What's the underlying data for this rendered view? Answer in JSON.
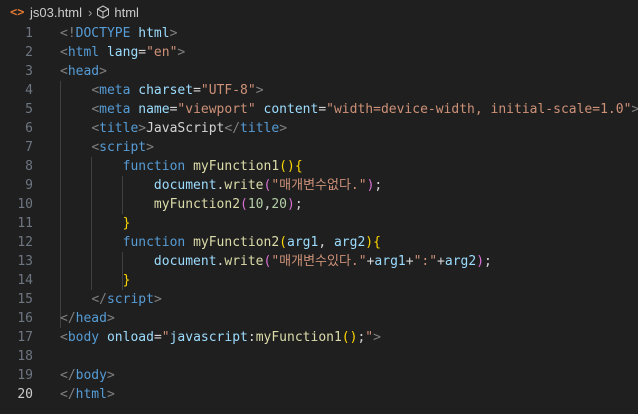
{
  "breadcrumb": {
    "file_icon": "<>",
    "file_name": "js03.html",
    "chevron": "›",
    "symbol_icon": "element-box-icon",
    "symbol_name": "html"
  },
  "editor": {
    "active_line": 20,
    "lines": [
      {
        "number": "1",
        "tokens": [
          {
            "t": "<!",
            "c": "punc"
          },
          {
            "t": "DOCTYPE",
            "c": "tag"
          },
          {
            "t": " ",
            "c": "text"
          },
          {
            "t": "html",
            "c": "attr"
          },
          {
            "t": ">",
            "c": "punc"
          }
        ]
      },
      {
        "number": "2",
        "tokens": [
          {
            "t": "<",
            "c": "punc"
          },
          {
            "t": "html",
            "c": "tag"
          },
          {
            "t": " ",
            "c": "text"
          },
          {
            "t": "lang",
            "c": "attr"
          },
          {
            "t": "=",
            "c": "text"
          },
          {
            "t": "\"en\"",
            "c": "str"
          },
          {
            "t": ">",
            "c": "punc"
          }
        ]
      },
      {
        "number": "3",
        "tokens": [
          {
            "t": "<",
            "c": "punc"
          },
          {
            "t": "head",
            "c": "tag"
          },
          {
            "t": ">",
            "c": "punc"
          }
        ]
      },
      {
        "number": "4",
        "tokens": [
          {
            "t": "    ",
            "c": "text"
          },
          {
            "t": "<",
            "c": "punc"
          },
          {
            "t": "meta",
            "c": "tag"
          },
          {
            "t": " ",
            "c": "text"
          },
          {
            "t": "charset",
            "c": "attr"
          },
          {
            "t": "=",
            "c": "text"
          },
          {
            "t": "\"UTF-8\"",
            "c": "str"
          },
          {
            "t": ">",
            "c": "punc"
          }
        ]
      },
      {
        "number": "5",
        "tokens": [
          {
            "t": "    ",
            "c": "text"
          },
          {
            "t": "<",
            "c": "punc"
          },
          {
            "t": "meta",
            "c": "tag"
          },
          {
            "t": " ",
            "c": "text"
          },
          {
            "t": "name",
            "c": "attr"
          },
          {
            "t": "=",
            "c": "text"
          },
          {
            "t": "\"viewport\"",
            "c": "str"
          },
          {
            "t": " ",
            "c": "text"
          },
          {
            "t": "content",
            "c": "attr"
          },
          {
            "t": "=",
            "c": "text"
          },
          {
            "t": "\"width=device-width, initial-scale=1.0\"",
            "c": "str"
          },
          {
            "t": ">",
            "c": "punc"
          }
        ]
      },
      {
        "number": "6",
        "tokens": [
          {
            "t": "    ",
            "c": "text"
          },
          {
            "t": "<",
            "c": "punc"
          },
          {
            "t": "title",
            "c": "tag"
          },
          {
            "t": ">",
            "c": "punc"
          },
          {
            "t": "JavaScript",
            "c": "text"
          },
          {
            "t": "</",
            "c": "punc"
          },
          {
            "t": "title",
            "c": "tag"
          },
          {
            "t": ">",
            "c": "punc"
          }
        ]
      },
      {
        "number": "7",
        "tokens": [
          {
            "t": "    ",
            "c": "text"
          },
          {
            "t": "<",
            "c": "punc"
          },
          {
            "t": "script",
            "c": "tag"
          },
          {
            "t": ">",
            "c": "punc"
          }
        ]
      },
      {
        "number": "8",
        "tokens": [
          {
            "t": "        ",
            "c": "text"
          },
          {
            "t": "function",
            "c": "kw"
          },
          {
            "t": " ",
            "c": "text"
          },
          {
            "t": "myFunction1",
            "c": "fn"
          },
          {
            "t": "()",
            "c": "br1"
          },
          {
            "t": "{",
            "c": "br1"
          }
        ]
      },
      {
        "number": "9",
        "tokens": [
          {
            "t": "            ",
            "c": "text"
          },
          {
            "t": "document",
            "c": "param"
          },
          {
            "t": ".",
            "c": "text"
          },
          {
            "t": "write",
            "c": "fn"
          },
          {
            "t": "(",
            "c": "br2"
          },
          {
            "t": "\"매개변수없다.\"",
            "c": "str"
          },
          {
            "t": ")",
            "c": "br2"
          },
          {
            "t": ";",
            "c": "text"
          }
        ]
      },
      {
        "number": "10",
        "tokens": [
          {
            "t": "            ",
            "c": "text"
          },
          {
            "t": "myFunction2",
            "c": "fn"
          },
          {
            "t": "(",
            "c": "br2"
          },
          {
            "t": "10",
            "c": "num"
          },
          {
            "t": ",",
            "c": "text"
          },
          {
            "t": "20",
            "c": "num"
          },
          {
            "t": ")",
            "c": "br2"
          },
          {
            "t": ";",
            "c": "text"
          }
        ]
      },
      {
        "number": "11",
        "tokens": [
          {
            "t": "        ",
            "c": "text"
          },
          {
            "t": "}",
            "c": "br1"
          }
        ]
      },
      {
        "number": "12",
        "tokens": [
          {
            "t": "        ",
            "c": "text"
          },
          {
            "t": "function",
            "c": "kw"
          },
          {
            "t": " ",
            "c": "text"
          },
          {
            "t": "myFunction2",
            "c": "fn"
          },
          {
            "t": "(",
            "c": "br1"
          },
          {
            "t": "arg1",
            "c": "param"
          },
          {
            "t": ", ",
            "c": "text"
          },
          {
            "t": "arg2",
            "c": "param"
          },
          {
            "t": ")",
            "c": "br1"
          },
          {
            "t": "{",
            "c": "br1"
          }
        ]
      },
      {
        "number": "13",
        "tokens": [
          {
            "t": "            ",
            "c": "text"
          },
          {
            "t": "document",
            "c": "param"
          },
          {
            "t": ".",
            "c": "text"
          },
          {
            "t": "write",
            "c": "fn"
          },
          {
            "t": "(",
            "c": "br2"
          },
          {
            "t": "\"매개변수있다.\"",
            "c": "str"
          },
          {
            "t": "+",
            "c": "op"
          },
          {
            "t": "arg1",
            "c": "param"
          },
          {
            "t": "+",
            "c": "op"
          },
          {
            "t": "\":\"",
            "c": "str"
          },
          {
            "t": "+",
            "c": "op"
          },
          {
            "t": "arg2",
            "c": "param"
          },
          {
            "t": ")",
            "c": "br2"
          },
          {
            "t": ";",
            "c": "text"
          }
        ]
      },
      {
        "number": "14",
        "tokens": [
          {
            "t": "        ",
            "c": "text"
          },
          {
            "t": "}",
            "c": "br1"
          }
        ]
      },
      {
        "number": "15",
        "tokens": [
          {
            "t": "    ",
            "c": "text"
          },
          {
            "t": "</",
            "c": "punc"
          },
          {
            "t": "script",
            "c": "tag"
          },
          {
            "t": ">",
            "c": "punc"
          }
        ]
      },
      {
        "number": "16",
        "tokens": [
          {
            "t": "</",
            "c": "punc"
          },
          {
            "t": "head",
            "c": "tag"
          },
          {
            "t": ">",
            "c": "punc"
          }
        ]
      },
      {
        "number": "17",
        "tokens": [
          {
            "t": "<",
            "c": "punc"
          },
          {
            "t": "body",
            "c": "tag"
          },
          {
            "t": " ",
            "c": "text"
          },
          {
            "t": "onload",
            "c": "attr"
          },
          {
            "t": "=",
            "c": "text"
          },
          {
            "t": "\"",
            "c": "str"
          },
          {
            "t": "javascript",
            "c": "param"
          },
          {
            "t": ":",
            "c": "text"
          },
          {
            "t": "myFunction1",
            "c": "fn"
          },
          {
            "t": "()",
            "c": "br1"
          },
          {
            "t": ";",
            "c": "text"
          },
          {
            "t": "\"",
            "c": "str"
          },
          {
            "t": ">",
            "c": "punc"
          }
        ]
      },
      {
        "number": "18",
        "tokens": []
      },
      {
        "number": "19",
        "tokens": [
          {
            "t": "</",
            "c": "punc"
          },
          {
            "t": "body",
            "c": "tag"
          },
          {
            "t": ">",
            "c": "punc"
          }
        ]
      },
      {
        "number": "20",
        "tokens": [
          {
            "t": "</",
            "c": "punc"
          },
          {
            "t": "html",
            "c": "tag"
          },
          {
            "t": ">",
            "c": "punc"
          }
        ]
      }
    ]
  },
  "colors": {
    "background": "#1f1f1f",
    "line_number": "#6e7681",
    "line_number_active": "#cccccc",
    "tag": "#569cd6",
    "attribute": "#9cdcfe",
    "string": "#ce9178",
    "function": "#dcdcaa",
    "number": "#b5cea8",
    "bracket_1": "#ffd700",
    "bracket_2": "#da70d6",
    "file_icon": "#e37933"
  }
}
